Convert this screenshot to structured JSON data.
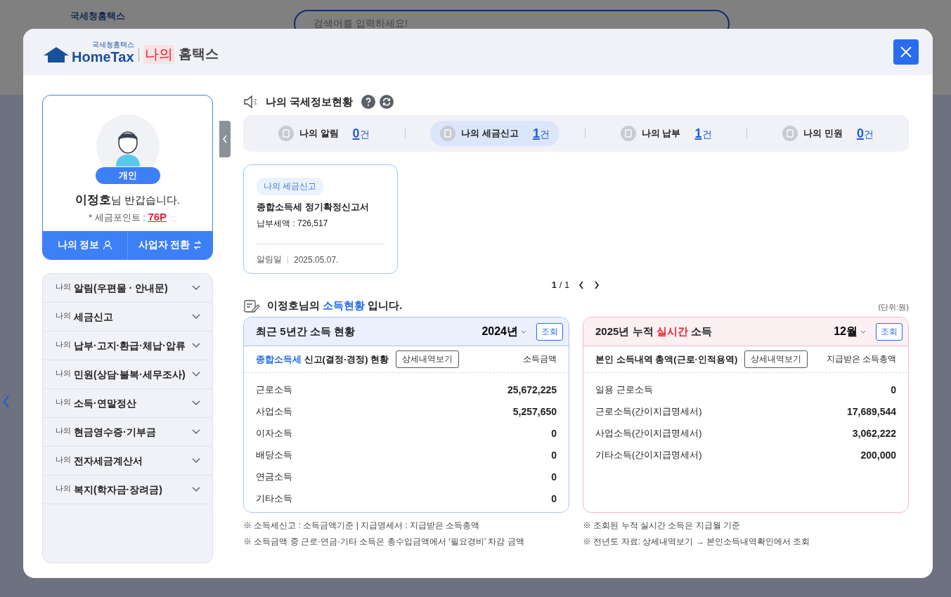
{
  "backdrop": {
    "logo_text": "국세청홈택스",
    "search_placeholder": "검색어를 입력하세요!"
  },
  "modal": {
    "logo_small": "국세청홈택스",
    "logo": "HomeTax",
    "title_accent": "나의",
    "title": "홈택스"
  },
  "profile": {
    "badge": "개인",
    "name": "이정호",
    "greeting": "님 반갑습니다.",
    "points_label": "* 세금포인트 :",
    "points": "76P",
    "buttons": [
      {
        "label": "나의 정보",
        "kind": "person"
      },
      {
        "label": "사업자 전환",
        "kind": "swap"
      }
    ]
  },
  "menu": [
    {
      "prefix": "나의",
      "label": "알림(우편물 · 안내문)"
    },
    {
      "prefix": "나의",
      "label": "세금신고"
    },
    {
      "prefix": "나의",
      "label": "납부·고지·환급·체납·압류"
    },
    {
      "prefix": "나의",
      "label": "민원(상담·불복·세무조사)"
    },
    {
      "prefix": "나의",
      "label": "소득·연말정산"
    },
    {
      "prefix": "나의",
      "label": "현금영수증·기부금"
    },
    {
      "prefix": "나의",
      "label": "전자세금계산서"
    },
    {
      "prefix": "나의",
      "label": "복지(학자금·장려금)"
    }
  ],
  "status": {
    "title": "나의 국세정보현황",
    "tabs": [
      {
        "label": "나의 알림",
        "count": "0",
        "unit": "건",
        "selected": false
      },
      {
        "label": "나의 세금신고",
        "count": "1",
        "unit": "건",
        "selected": true
      },
      {
        "label": "나의 납부",
        "count": "1",
        "unit": "건",
        "selected": false
      },
      {
        "label": "나의 민원",
        "count": "0",
        "unit": "건",
        "selected": false
      }
    ]
  },
  "cards": [
    {
      "tag": "나의 세금신고",
      "title": "종합소득세 정기확정신고서",
      "detail": "납부세액 : 726,517",
      "date_label": "알림일",
      "date": "2025.05.07."
    }
  ],
  "pager": {
    "current": "1",
    "total": "/ 1"
  },
  "income": {
    "title_parts": [
      {
        "text": "이정호님의 ",
        "highlight": false
      },
      {
        "text": "소득현황",
        "highlight": true
      },
      {
        "text": " 입니다.",
        "highlight": false
      }
    ],
    "unit": "(단위:원)",
    "panels": [
      {
        "kind": "yearly",
        "title_parts": [
          {
            "text": "최근 5년간 소득 현황",
            "highlight": false
          }
        ],
        "period": "2024년",
        "query": "조회",
        "sub_parts": [
          {
            "text": "종합소득세",
            "highlight": true
          },
          {
            "text": " 신고(결정·경정) 현황",
            "highlight": false
          }
        ],
        "detail_button": "상세내역보기",
        "column": "소득금액",
        "rows": [
          {
            "label": "근로소득",
            "value": "25,672,225"
          },
          {
            "label": "사업소득",
            "value": "5,257,650"
          },
          {
            "label": "이자소득",
            "value": "0"
          },
          {
            "label": "배당소득",
            "value": "0"
          },
          {
            "label": "연금소득",
            "value": "0"
          },
          {
            "label": "기타소득",
            "value": "0"
          }
        ],
        "notes": [
          "※ 소득세신고 : 소득금액기준 | 지급명세서 : 지급받은 소득총액",
          "※ 소득금액 중 근로·연금·기타 소득은 총수입금액에서 ‘필요경비’ 차감 금액"
        ]
      },
      {
        "kind": "realtime",
        "title_parts": [
          {
            "text": "2025년 누적 ",
            "highlight": false
          },
          {
            "text": "실시간",
            "highlight": true
          },
          {
            "text": " 소득",
            "highlight": false
          }
        ],
        "period": "12월",
        "query": "조회",
        "sub_parts": [
          {
            "text": "본인 소득내역 총액(근로·인적용역)",
            "highlight": false
          }
        ],
        "detail_button": "상세내역보기",
        "column": "지급받은 소득총액",
        "rows": [
          {
            "label": "일용 근로소득",
            "value": "0"
          },
          {
            "label": "근로소득(간이지급명세서)",
            "value": "17,689,544"
          },
          {
            "label": "사업소득(간이지급명세서)",
            "value": "3,062,222"
          },
          {
            "label": "기타소득(간이지급명세서)",
            "value": "200,000"
          }
        ],
        "notes": [
          "※ 조회된 누적 실시간 소득은 지급월 기준",
          "※ 전년도 자료: 상세내역보기 → 본인소득내역확인에서 조회"
        ]
      }
    ]
  }
}
